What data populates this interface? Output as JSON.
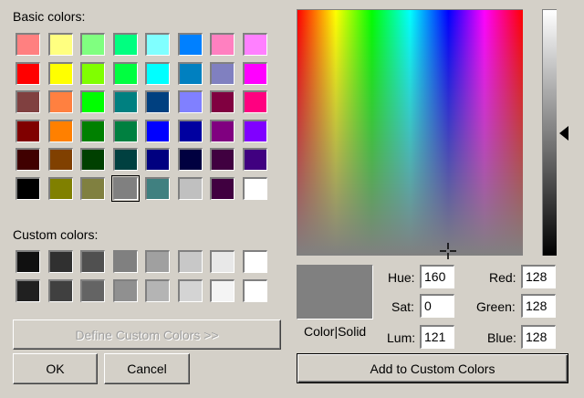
{
  "labels": {
    "basic_colors": "Basic colors:",
    "custom_colors": "Custom colors:",
    "color_solid": "Color|Solid"
  },
  "basic_colors": [
    [
      "#ff8080",
      "#ffff80",
      "#80ff80",
      "#00ff80",
      "#80ffff",
      "#0080ff",
      "#ff80c0",
      "#ff80ff"
    ],
    [
      "#ff0000",
      "#ffff00",
      "#80ff00",
      "#00ff40",
      "#00ffff",
      "#0080c0",
      "#8080c0",
      "#ff00ff"
    ],
    [
      "#804040",
      "#ff8040",
      "#00ff00",
      "#008080",
      "#004080",
      "#8080ff",
      "#800040",
      "#ff0080"
    ],
    [
      "#800000",
      "#ff8000",
      "#008000",
      "#008040",
      "#0000ff",
      "#0000a0",
      "#800080",
      "#8000ff"
    ],
    [
      "#400000",
      "#804000",
      "#004000",
      "#004040",
      "#000080",
      "#000040",
      "#400040",
      "#400080"
    ],
    [
      "#000000",
      "#808000",
      "#808040",
      "#808080",
      "#408080",
      "#c0c0c0",
      "#400040",
      "#ffffff"
    ]
  ],
  "selected_basic": "#808080",
  "custom_colors": [
    [
      "#101010",
      "#303030",
      "#505050",
      "#808080",
      "#a0a0a0",
      "#c8c8c8",
      "#e8e8e8",
      "#ffffff"
    ],
    [
      "#202020",
      "#404040",
      "#646464",
      "#909090",
      "#b4b4b4",
      "#d4d4d4",
      "#f4f4f4",
      "#ffffff"
    ]
  ],
  "preview_color": "#808080",
  "buttons": {
    "define_custom": "Define Custom Colors >>",
    "ok": "OK",
    "cancel": "Cancel",
    "add_custom": "Add to Custom Colors"
  },
  "fields": {
    "hue": {
      "label": "Hue:",
      "value": "160"
    },
    "sat": {
      "label": "Sat:",
      "value": "0"
    },
    "lum": {
      "label": "Lum:",
      "value": "121"
    },
    "red": {
      "label": "Red:",
      "value": "128"
    },
    "green": {
      "label": "Green:",
      "value": "128"
    },
    "blue": {
      "label": "Blue:",
      "value": "128"
    }
  }
}
